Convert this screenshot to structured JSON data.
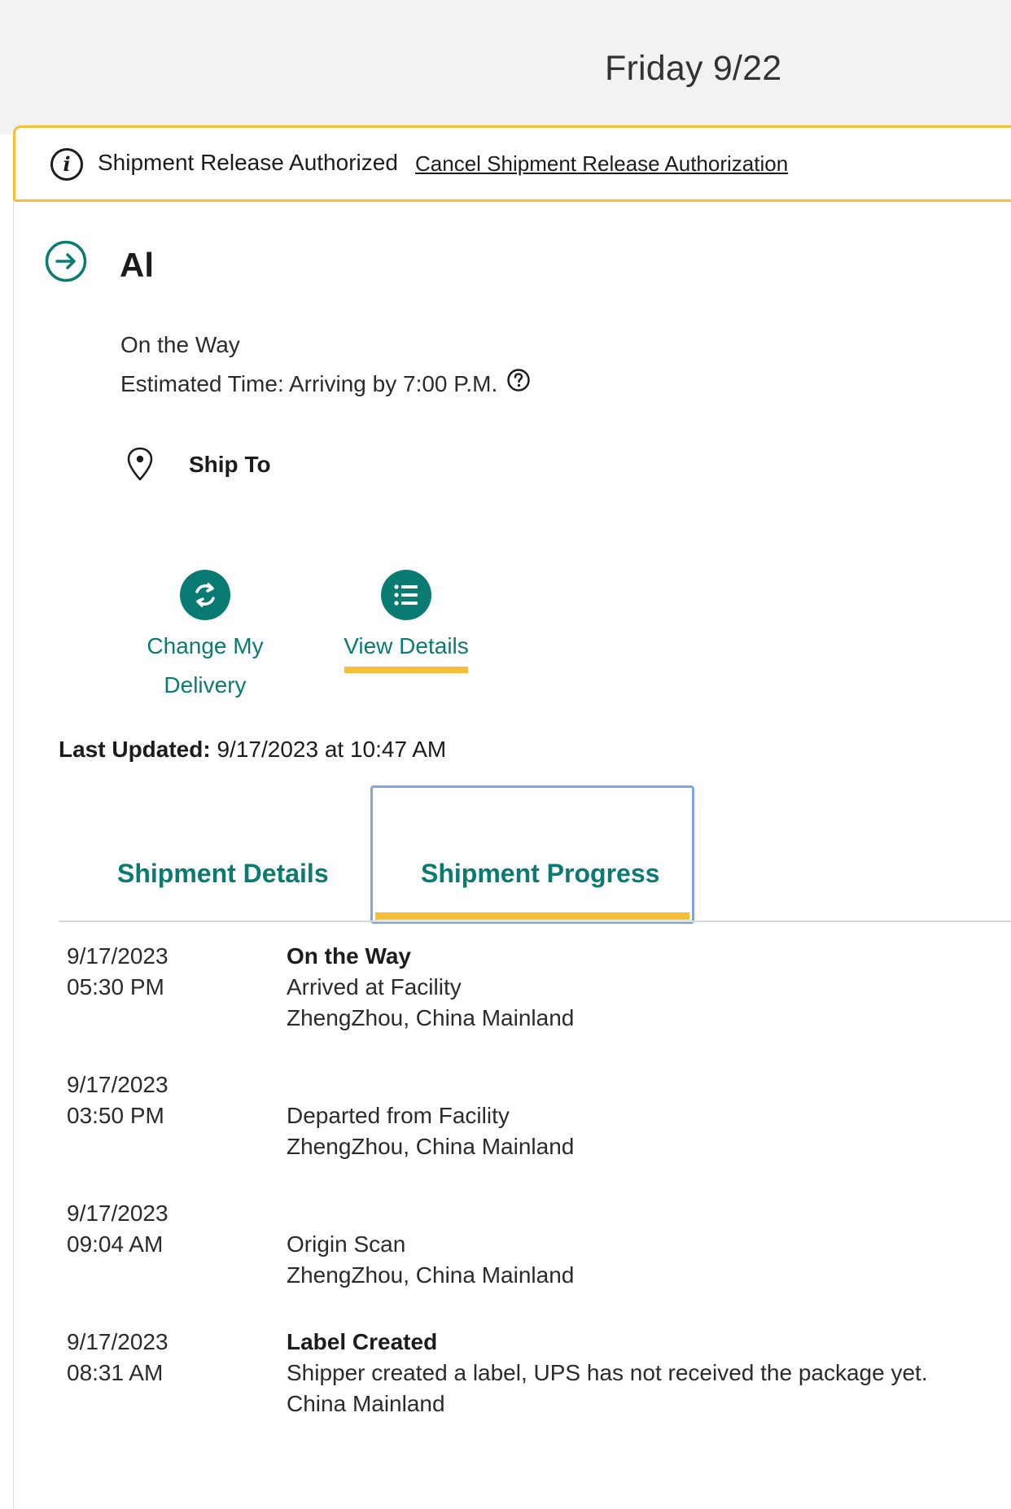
{
  "header": {
    "date": "Friday 9/22"
  },
  "alert": {
    "icon": "info-icon",
    "message": "Shipment Release Authorized",
    "link": "Cancel Shipment Release Authorization"
  },
  "shipment": {
    "recipient": "Al",
    "status": "On the Way",
    "estimated_time": "Estimated Time: Arriving by 7:00 P.M.",
    "ship_to_label": "Ship To"
  },
  "actions": {
    "change_delivery_line1": "Change My",
    "change_delivery_line2": "Delivery",
    "view_details": "View Details"
  },
  "last_updated": {
    "label": "Last Updated:",
    "value": "9/17/2023 at 10:47 AM"
  },
  "tabs": {
    "details": "Shipment Details",
    "progress": "Shipment Progress"
  },
  "events": [
    {
      "date": "9/17/2023",
      "time": "05:30 PM",
      "status": "On the Way",
      "description": "Arrived at Facility",
      "location": "ZhengZhou, China Mainland"
    },
    {
      "date": "9/17/2023",
      "time": "03:50 PM",
      "status": "",
      "description": "Departed from Facility",
      "location": "ZhengZhou, China Mainland"
    },
    {
      "date": "9/17/2023",
      "time": "09:04 AM",
      "status": "",
      "description": "Origin Scan",
      "location": "ZhengZhou, China Mainland"
    },
    {
      "date": "9/17/2023",
      "time": "08:31 AM",
      "status": "Label Created",
      "description": "Shipper created a label, UPS has not received the package yet.",
      "location": "China Mainland"
    }
  ],
  "colors": {
    "accent": "#0a7b72",
    "highlight": "#f6bd36",
    "focus": "#7fa6e2"
  }
}
